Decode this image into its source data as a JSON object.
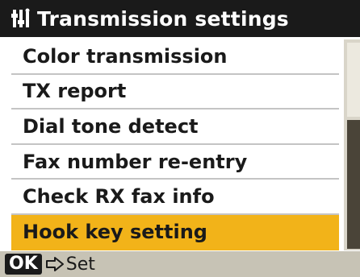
{
  "header": {
    "icon": "settings-icon",
    "title": "Transmission settings"
  },
  "menu": {
    "items": [
      {
        "label": "Color transmission",
        "selected": false
      },
      {
        "label": "TX report",
        "selected": false
      },
      {
        "label": "Dial tone detect",
        "selected": false
      },
      {
        "label": "Fax number re-entry",
        "selected": false
      },
      {
        "label": "Check RX fax info",
        "selected": false
      },
      {
        "label": "Hook key setting",
        "selected": true
      }
    ]
  },
  "footer": {
    "ok_key": "OK",
    "arrow_icon": "arrow-right-icon",
    "action_label": "Set"
  },
  "colors": {
    "title_bar": "#1a1a1a",
    "highlight": "#f2b319",
    "footer_bar": "#c7c3b5"
  }
}
